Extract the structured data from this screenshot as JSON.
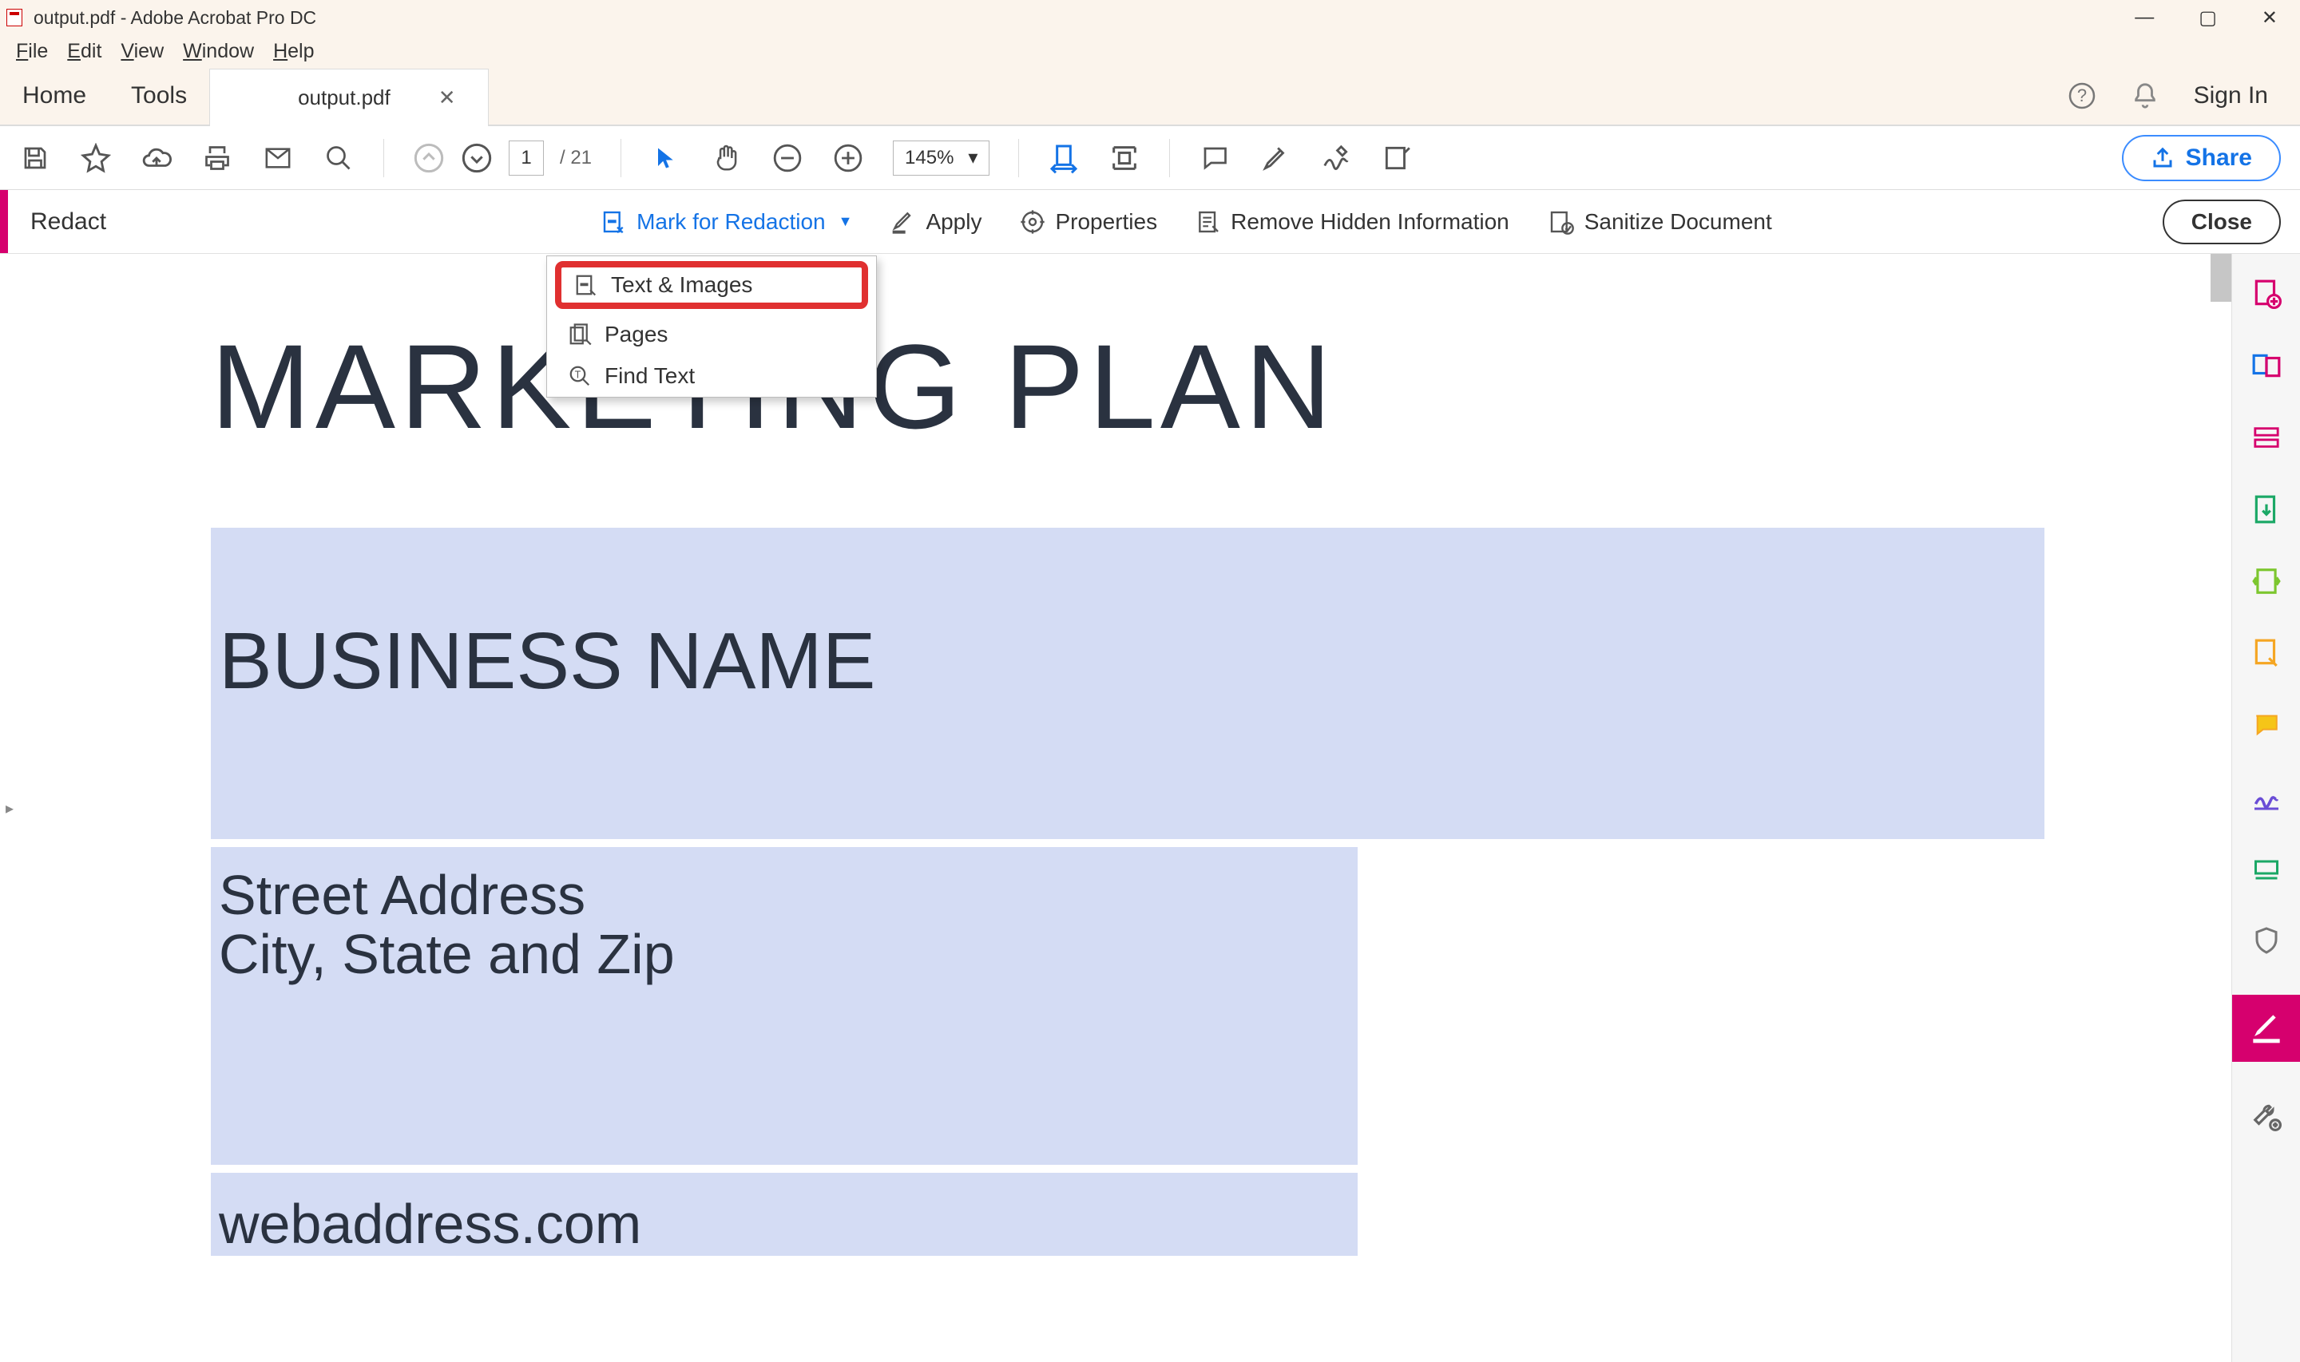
{
  "titlebar": {
    "title": "output.pdf - Adobe Acrobat Pro DC"
  },
  "menubar": {
    "file": "File",
    "edit": "Edit",
    "view": "View",
    "window": "Window",
    "help": "Help"
  },
  "tabs": {
    "home": "Home",
    "tools": "Tools",
    "doc": "output.pdf",
    "signin": "Sign In"
  },
  "toolbar": {
    "page_current": "1",
    "page_total": "/  21",
    "zoom": "145%",
    "share": "Share"
  },
  "redact": {
    "label": "Redact",
    "mark": "Mark for Redaction",
    "apply": "Apply",
    "properties": "Properties",
    "remove": "Remove Hidden Information",
    "sanitize": "Sanitize Document",
    "close": "Close"
  },
  "dropdown": {
    "text_images": "Text & Images",
    "pages": "Pages",
    "find_text": "Find Text"
  },
  "document": {
    "title": "MARKETING PLAN",
    "business": "BUSINESS NAME",
    "street": "Street Address",
    "city": "City, State and Zip",
    "web": "webaddress.com"
  }
}
